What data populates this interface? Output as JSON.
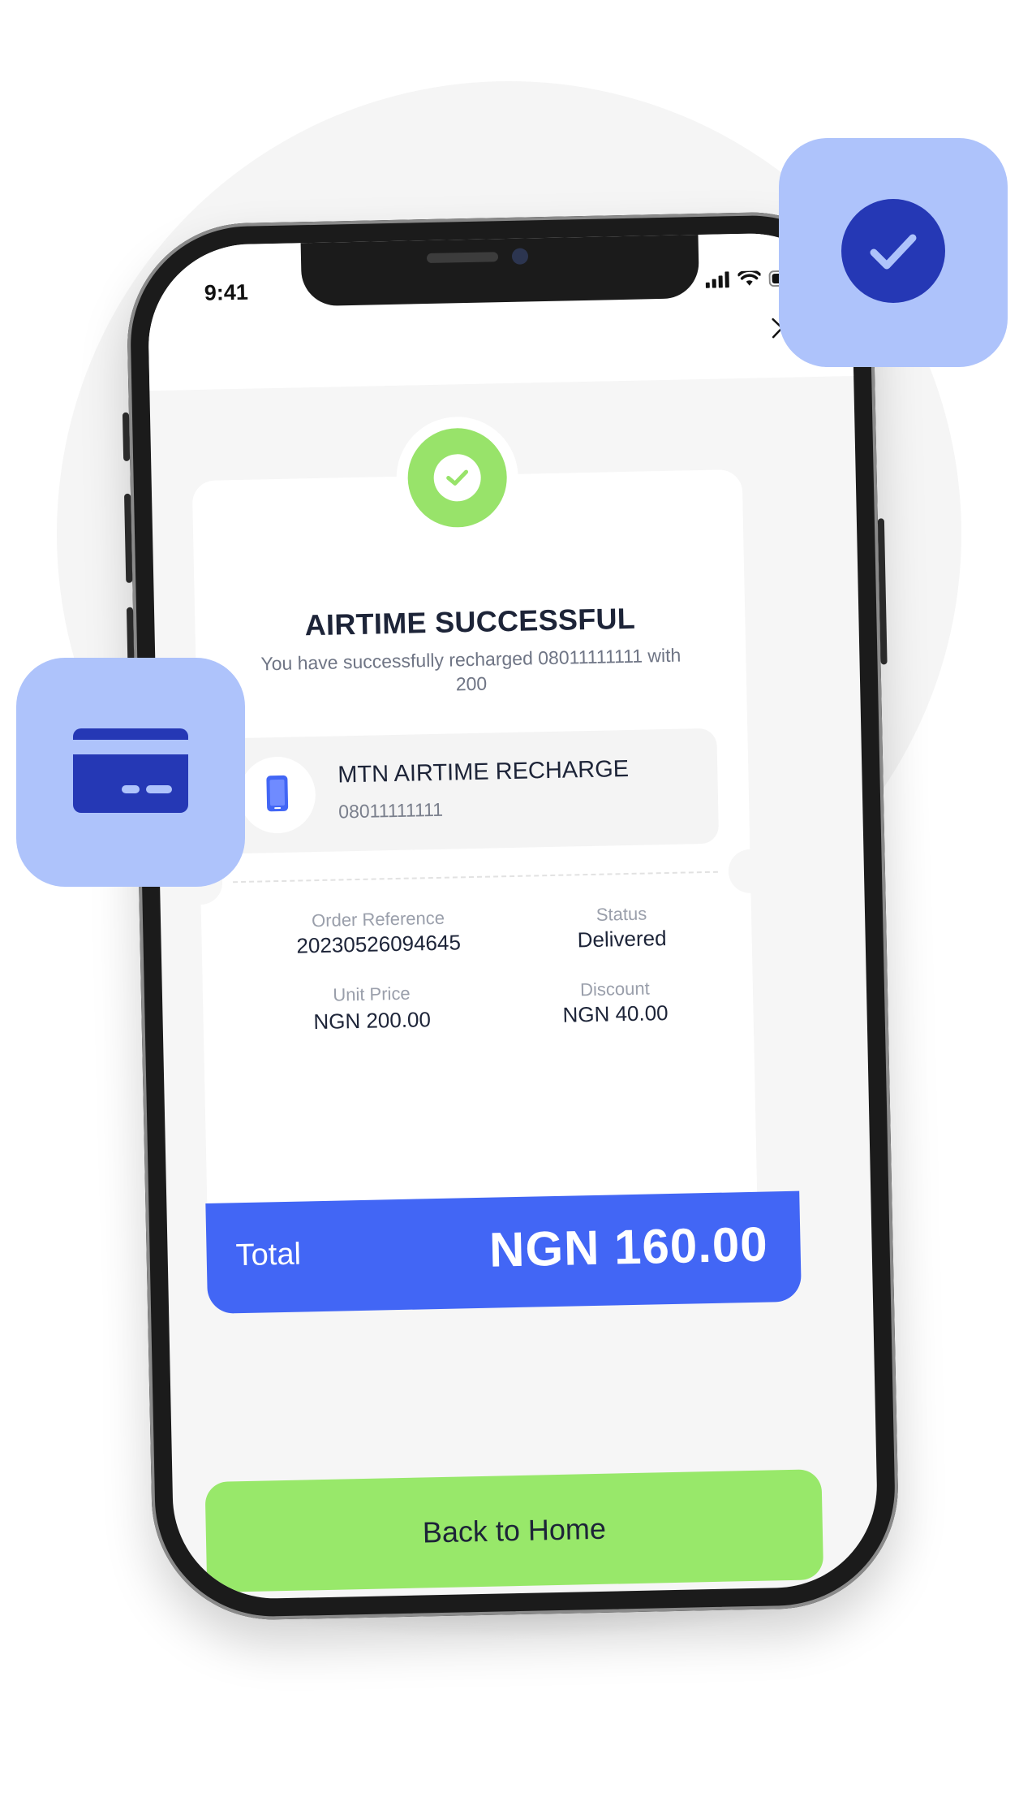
{
  "status_bar": {
    "time": "9:41"
  },
  "receipt": {
    "title": "AIRTIME SUCCESSFUL",
    "subtitle": "You have successfully recharged 08011111111 with 200",
    "product": {
      "name": "MTN AIRTIME RECHARGE",
      "phone": "08011111111"
    },
    "details": {
      "order_reference_label": "Order Reference",
      "order_reference_value": "20230526094645",
      "status_label": "Status",
      "status_value": "Delivered",
      "unit_price_label": "Unit Price",
      "unit_price_value": "NGN 200.00",
      "discount_label": "Discount",
      "discount_value": "NGN 40.00"
    },
    "total_label": "Total",
    "total_value": "NGN 160.00"
  },
  "actions": {
    "back_home_label": "Back to Home"
  },
  "icons": {
    "close": "close-icon",
    "success": "check-icon",
    "product": "phone-icon",
    "float_check": "check-circle-icon",
    "float_card": "credit-card-icon",
    "signal": "signal-icon",
    "wifi": "wifi-icon",
    "battery": "battery-icon"
  },
  "colors": {
    "accent_blue": "#4266f5",
    "success_green": "#98e36a",
    "button_green": "#98e86a",
    "tile_blue": "#aec3fb",
    "dark_navy": "#2538b5",
    "text_dark": "#1d2438"
  }
}
